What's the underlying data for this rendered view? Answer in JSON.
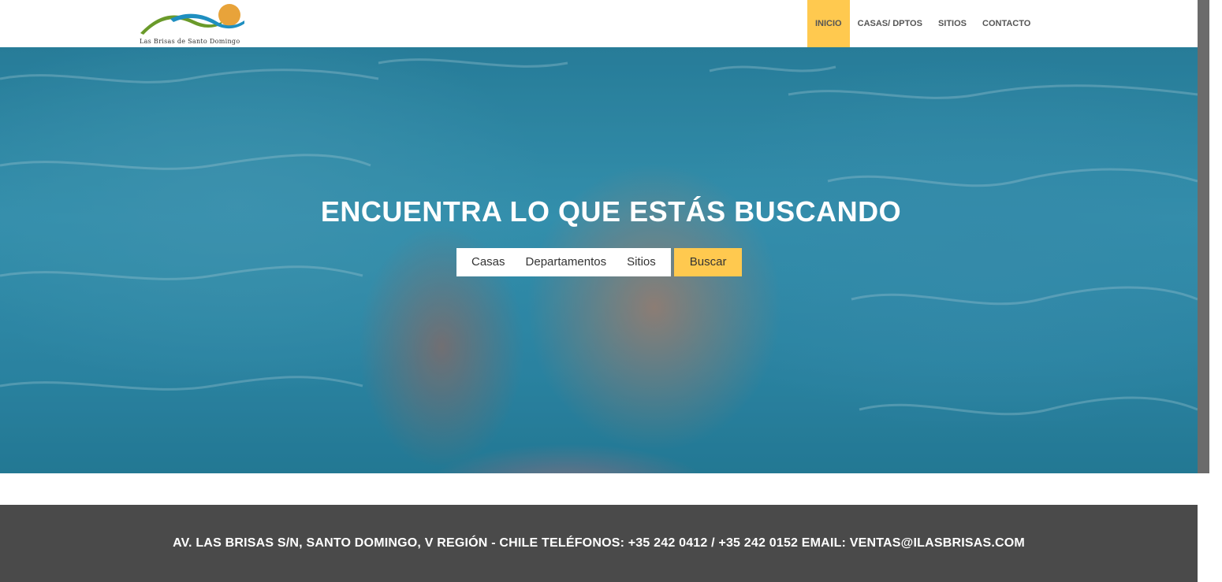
{
  "header": {
    "logo_text": "Las Brisas de Santo Domingo",
    "nav": [
      {
        "label": "INICIO",
        "active": true
      },
      {
        "label": "CASAS/ DPTOS",
        "active": false
      },
      {
        "label": "SITIOS",
        "active": false
      },
      {
        "label": "CONTACTO",
        "active": false
      }
    ]
  },
  "hero": {
    "title": "ENCUENTRA LO QUE ESTÁS BUSCANDO",
    "search_tabs": [
      "Casas",
      "Departamentos",
      "Sitios"
    ],
    "search_button": "Buscar"
  },
  "footer": {
    "text": "AV. LAS BRISAS S/N, SANTO DOMINGO, V REGIÓN - CHILE TELÉFONOS: +35 242 0412 / +35 242 0152 EMAIL: VENTAS@ILASBRISAS.COM"
  },
  "colors": {
    "accent": "#ffc94f",
    "footer_bg": "#4a4a4a",
    "nav_text": "#555555"
  }
}
